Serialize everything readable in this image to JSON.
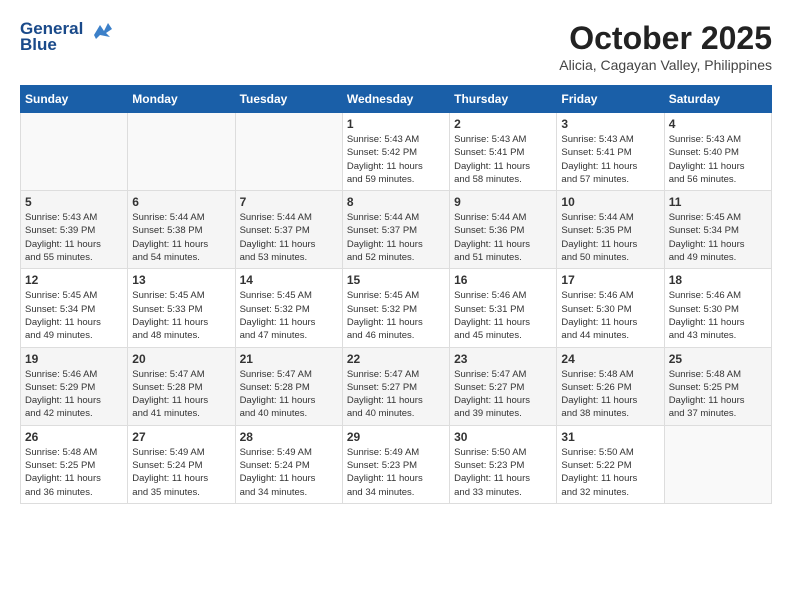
{
  "header": {
    "logo_line1": "General",
    "logo_line2": "Blue",
    "title": "October 2025",
    "subtitle": "Alicia, Cagayan Valley, Philippines"
  },
  "weekdays": [
    "Sunday",
    "Monday",
    "Tuesday",
    "Wednesday",
    "Thursday",
    "Friday",
    "Saturday"
  ],
  "weeks": [
    [
      {
        "day": "",
        "info": ""
      },
      {
        "day": "",
        "info": ""
      },
      {
        "day": "",
        "info": ""
      },
      {
        "day": "1",
        "info": "Sunrise: 5:43 AM\nSunset: 5:42 PM\nDaylight: 11 hours\nand 59 minutes."
      },
      {
        "day": "2",
        "info": "Sunrise: 5:43 AM\nSunset: 5:41 PM\nDaylight: 11 hours\nand 58 minutes."
      },
      {
        "day": "3",
        "info": "Sunrise: 5:43 AM\nSunset: 5:41 PM\nDaylight: 11 hours\nand 57 minutes."
      },
      {
        "day": "4",
        "info": "Sunrise: 5:43 AM\nSunset: 5:40 PM\nDaylight: 11 hours\nand 56 minutes."
      }
    ],
    [
      {
        "day": "5",
        "info": "Sunrise: 5:43 AM\nSunset: 5:39 PM\nDaylight: 11 hours\nand 55 minutes."
      },
      {
        "day": "6",
        "info": "Sunrise: 5:44 AM\nSunset: 5:38 PM\nDaylight: 11 hours\nand 54 minutes."
      },
      {
        "day": "7",
        "info": "Sunrise: 5:44 AM\nSunset: 5:37 PM\nDaylight: 11 hours\nand 53 minutes."
      },
      {
        "day": "8",
        "info": "Sunrise: 5:44 AM\nSunset: 5:37 PM\nDaylight: 11 hours\nand 52 minutes."
      },
      {
        "day": "9",
        "info": "Sunrise: 5:44 AM\nSunset: 5:36 PM\nDaylight: 11 hours\nand 51 minutes."
      },
      {
        "day": "10",
        "info": "Sunrise: 5:44 AM\nSunset: 5:35 PM\nDaylight: 11 hours\nand 50 minutes."
      },
      {
        "day": "11",
        "info": "Sunrise: 5:45 AM\nSunset: 5:34 PM\nDaylight: 11 hours\nand 49 minutes."
      }
    ],
    [
      {
        "day": "12",
        "info": "Sunrise: 5:45 AM\nSunset: 5:34 PM\nDaylight: 11 hours\nand 49 minutes."
      },
      {
        "day": "13",
        "info": "Sunrise: 5:45 AM\nSunset: 5:33 PM\nDaylight: 11 hours\nand 48 minutes."
      },
      {
        "day": "14",
        "info": "Sunrise: 5:45 AM\nSunset: 5:32 PM\nDaylight: 11 hours\nand 47 minutes."
      },
      {
        "day": "15",
        "info": "Sunrise: 5:45 AM\nSunset: 5:32 PM\nDaylight: 11 hours\nand 46 minutes."
      },
      {
        "day": "16",
        "info": "Sunrise: 5:46 AM\nSunset: 5:31 PM\nDaylight: 11 hours\nand 45 minutes."
      },
      {
        "day": "17",
        "info": "Sunrise: 5:46 AM\nSunset: 5:30 PM\nDaylight: 11 hours\nand 44 minutes."
      },
      {
        "day": "18",
        "info": "Sunrise: 5:46 AM\nSunset: 5:30 PM\nDaylight: 11 hours\nand 43 minutes."
      }
    ],
    [
      {
        "day": "19",
        "info": "Sunrise: 5:46 AM\nSunset: 5:29 PM\nDaylight: 11 hours\nand 42 minutes."
      },
      {
        "day": "20",
        "info": "Sunrise: 5:47 AM\nSunset: 5:28 PM\nDaylight: 11 hours\nand 41 minutes."
      },
      {
        "day": "21",
        "info": "Sunrise: 5:47 AM\nSunset: 5:28 PM\nDaylight: 11 hours\nand 40 minutes."
      },
      {
        "day": "22",
        "info": "Sunrise: 5:47 AM\nSunset: 5:27 PM\nDaylight: 11 hours\nand 40 minutes."
      },
      {
        "day": "23",
        "info": "Sunrise: 5:47 AM\nSunset: 5:27 PM\nDaylight: 11 hours\nand 39 minutes."
      },
      {
        "day": "24",
        "info": "Sunrise: 5:48 AM\nSunset: 5:26 PM\nDaylight: 11 hours\nand 38 minutes."
      },
      {
        "day": "25",
        "info": "Sunrise: 5:48 AM\nSunset: 5:25 PM\nDaylight: 11 hours\nand 37 minutes."
      }
    ],
    [
      {
        "day": "26",
        "info": "Sunrise: 5:48 AM\nSunset: 5:25 PM\nDaylight: 11 hours\nand 36 minutes."
      },
      {
        "day": "27",
        "info": "Sunrise: 5:49 AM\nSunset: 5:24 PM\nDaylight: 11 hours\nand 35 minutes."
      },
      {
        "day": "28",
        "info": "Sunrise: 5:49 AM\nSunset: 5:24 PM\nDaylight: 11 hours\nand 34 minutes."
      },
      {
        "day": "29",
        "info": "Sunrise: 5:49 AM\nSunset: 5:23 PM\nDaylight: 11 hours\nand 34 minutes."
      },
      {
        "day": "30",
        "info": "Sunrise: 5:50 AM\nSunset: 5:23 PM\nDaylight: 11 hours\nand 33 minutes."
      },
      {
        "day": "31",
        "info": "Sunrise: 5:50 AM\nSunset: 5:22 PM\nDaylight: 11 hours\nand 32 minutes."
      },
      {
        "day": "",
        "info": ""
      }
    ]
  ]
}
